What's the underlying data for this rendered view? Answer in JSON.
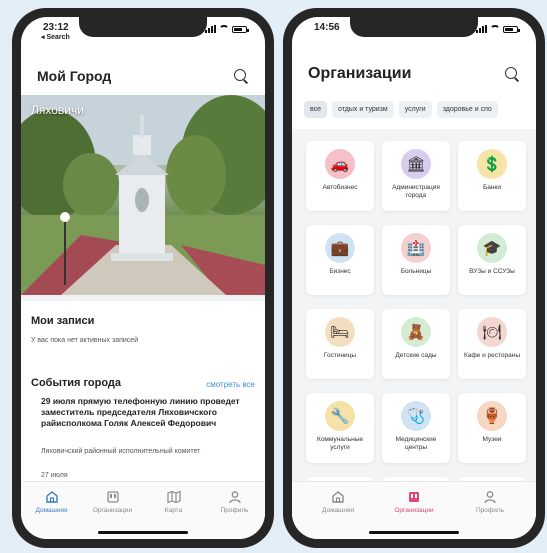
{
  "left": {
    "status": {
      "time": "23:12",
      "back": "◂ Search"
    },
    "header": {
      "title": "Мой Город"
    },
    "hero": {
      "caption": "Ляховичи"
    },
    "records": {
      "title": "Мои записи",
      "empty": "У вас пока нет активных записей"
    },
    "events": {
      "title": "События города",
      "see_all": "смотреть все",
      "item_title": "29 июля прямую телефонную линию проведет заместитель председателя Ляховичского райисполкома Голяк Алексей Федорович",
      "item_org": "Ляховичский районный исполнительный комитет",
      "item_date": "27 июля"
    },
    "tabs": [
      "Домашняя",
      "Организации",
      "Карта",
      "Профиль"
    ]
  },
  "right": {
    "status": {
      "time": "14:56"
    },
    "header": {
      "title": "Организации"
    },
    "chips": [
      "все",
      "отдых и туризм",
      "услуги",
      "здоровье и спо"
    ],
    "cards": [
      {
        "label": "Автобизнес",
        "icon": "car-icon",
        "glyph": "🚗",
        "color": "#f3c1c7"
      },
      {
        "label": "Администрация города",
        "icon": "building-icon",
        "glyph": "🏛",
        "color": "#d9cdee"
      },
      {
        "label": "Банки",
        "icon": "bank-icon",
        "glyph": "💲",
        "color": "#f6e3a6"
      },
      {
        "label": "Бизнес",
        "icon": "briefcase-icon",
        "glyph": "💼",
        "color": "#cfe3f4"
      },
      {
        "label": "Больницы",
        "icon": "hospital-icon",
        "glyph": "🏥",
        "color": "#f6cfcf"
      },
      {
        "label": "ВУЗы и ССУЗы",
        "icon": "school-icon",
        "glyph": "🎓",
        "color": "#d3ecd5"
      },
      {
        "label": "Гостиницы",
        "icon": "hotel-icon",
        "glyph": "🛏",
        "color": "#f3dfbf"
      },
      {
        "label": "Детские сады",
        "icon": "kindergarten-icon",
        "glyph": "🧸",
        "color": "#d6ecd2"
      },
      {
        "label": "Кафе и рестораны",
        "icon": "restaurant-icon",
        "glyph": "🍽",
        "color": "#f4d6d0"
      },
      {
        "label": "Коммунальные услуги",
        "icon": "utilities-icon",
        "glyph": "🔧",
        "color": "#f6e2a8"
      },
      {
        "label": "Медицинские центры",
        "icon": "doctor-icon",
        "glyph": "🩺",
        "color": "#cfe3f4"
      },
      {
        "label": "Музеи",
        "icon": "museum-icon",
        "glyph": "🏺",
        "color": "#f7d6c2"
      },
      {
        "label": "",
        "icon": "partial-icon",
        "glyph": "",
        "color": "#f3d2d2"
      },
      {
        "label": "",
        "icon": "partial-icon",
        "glyph": "",
        "color": "#f6e2a8"
      },
      {
        "label": "",
        "icon": "partial-icon",
        "glyph": "",
        "color": "#f7d6c2"
      }
    ],
    "tabs": [
      "Домашняя",
      "Организации",
      "Профиль"
    ]
  }
}
